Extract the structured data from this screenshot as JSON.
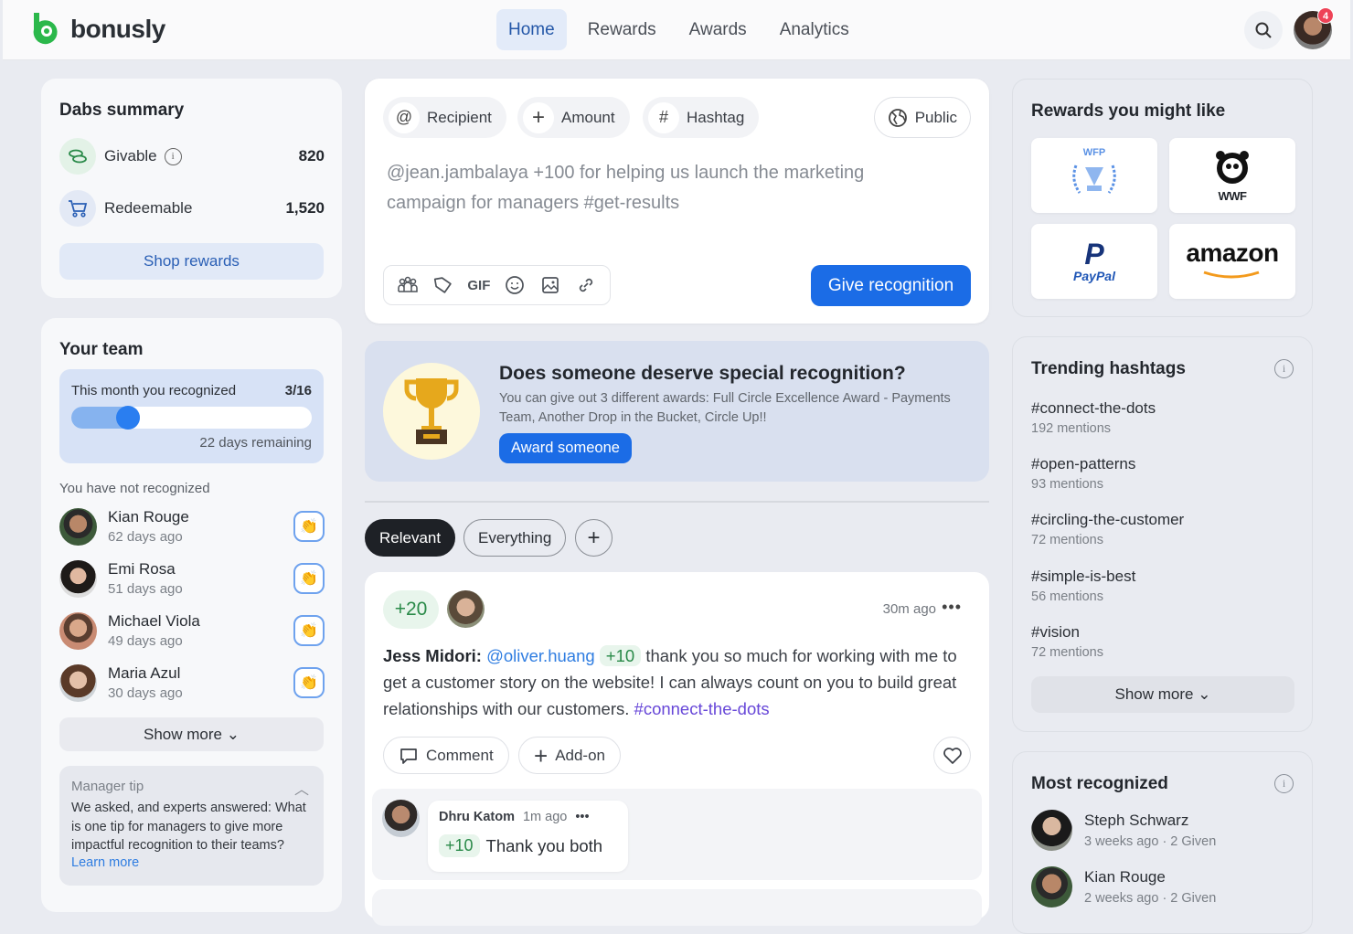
{
  "app": {
    "name": "bonusly",
    "notification_count": "4"
  },
  "nav": {
    "items": [
      {
        "label": "Home",
        "active": true
      },
      {
        "label": "Rewards"
      },
      {
        "label": "Awards"
      },
      {
        "label": "Analytics"
      }
    ]
  },
  "dabs": {
    "title": "Dabs summary",
    "givable_label": "Givable",
    "givable_value": "820",
    "redeemable_label": "Redeemable",
    "redeemable_value": "1,520",
    "shop_label": "Shop rewards"
  },
  "team": {
    "title": "Your team",
    "progress_label": "This month you recognized",
    "progress_count": "3/16",
    "progress_fraction": 0.1875,
    "days_remaining": "22 days remaining",
    "not_recognized_label": "You have not recognized",
    "members": [
      {
        "name": "Kian Rouge",
        "since": "62 days ago"
      },
      {
        "name": "Emi Rosa",
        "since": "51 days ago"
      },
      {
        "name": "Michael Viola",
        "since": "49 days ago"
      },
      {
        "name": "Maria Azul",
        "since": "30 days ago"
      }
    ],
    "show_more": "Show more",
    "tip_title": "Manager tip",
    "tip_body": "We asked, and experts answered: What is one tip for managers to give more impactful recognition to their teams?",
    "tip_link": "Learn more"
  },
  "composer": {
    "chips": [
      "Recipient",
      "Amount",
      "Hashtag"
    ],
    "visibility": "Public",
    "placeholder": "@jean.jambalaya +100 for helping us launch the marketing campaign for managers #get-results",
    "gif_label": "GIF",
    "submit_label": "Give recognition"
  },
  "award": {
    "title": "Does someone deserve special recognition?",
    "description": "You can give out 3 different awards: Full Circle Excellence Award - Payments Team, Another Drop in the Bucket, Circle Up!!",
    "button": "Award someone"
  },
  "filters": {
    "relevant": "Relevant",
    "everything": "Everything",
    "add": "+"
  },
  "post": {
    "points": "+20",
    "time": "30m ago",
    "author": "Jess Midori:",
    "mention": "@oliver.huang",
    "amount": "+10",
    "text": "thank you so much for working with me to get a customer story on the website! I can always count on you to build great relationships with our customers.",
    "hashtag": "#connect-the-dots",
    "comment_label": "Comment",
    "addon_label": "Add-on",
    "reply": {
      "author": "Dhru Katom",
      "time": "1m ago",
      "amount": "+10",
      "text": "Thank you both"
    }
  },
  "rewards": {
    "title": "Rewards you might like",
    "items": [
      "WFP",
      "WWF",
      "PayPal",
      "amazon"
    ]
  },
  "trending": {
    "title": "Trending hashtags",
    "tags": [
      {
        "name": "#connect-the-dots",
        "count": "192 mentions"
      },
      {
        "name": "#open-patterns",
        "count": "93 mentions"
      },
      {
        "name": "#circling-the-customer",
        "count": "72 mentions"
      },
      {
        "name": "#simple-is-best",
        "count": "56 mentions"
      },
      {
        "name": "#vision",
        "count": "72 mentions"
      }
    ],
    "show_more": "Show more"
  },
  "most_recognized": {
    "title": "Most recognized",
    "people": [
      {
        "name": "Steph Schwarz",
        "sub": "3 weeks ago · 2 Given"
      },
      {
        "name": "Kian Rouge",
        "sub": "2 weeks ago · 2 Given"
      }
    ]
  }
}
